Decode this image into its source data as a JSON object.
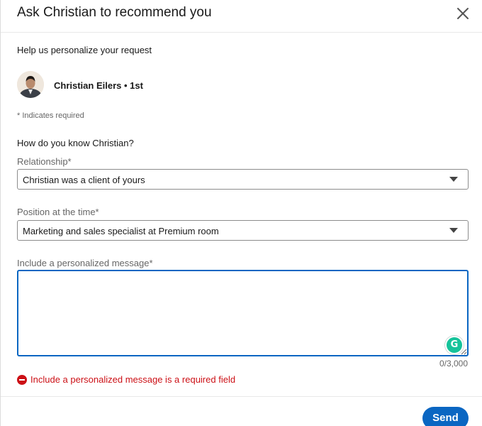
{
  "dialog": {
    "title": "Ask Christian to recommend you",
    "subtitle": "Help us personalize your request"
  },
  "person": {
    "name": "Christian Eilers • 1st"
  },
  "form": {
    "required_note": "* Indicates required",
    "question": "How do you know Christian?",
    "relationship": {
      "label": "Relationship*",
      "value": "Christian was a client of yours"
    },
    "position": {
      "label": "Position at the time*",
      "value": "Marketing and sales specialist at Premium room"
    },
    "message": {
      "label": "Include a personalized message*",
      "value": "",
      "char_count": "0/3,000"
    },
    "error": "Include a personalized message is a required field"
  },
  "footer": {
    "send_label": "Send"
  },
  "colors": {
    "primary": "#0a66c2",
    "error": "#cc1016",
    "grammarly": "#15c39a"
  },
  "icons": {
    "close": "close-icon",
    "caret": "chevron-down-icon",
    "error": "error-icon",
    "grammarly": "grammarly-icon"
  }
}
